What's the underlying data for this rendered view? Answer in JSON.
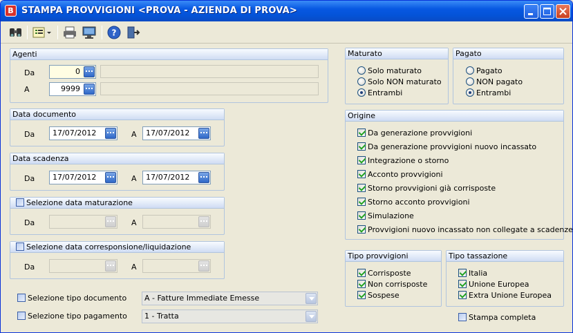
{
  "window": {
    "title": "STAMPA PROVVIGIONI <PROVA - AZIENDA DI PROVA>",
    "app_icon_letter": "B"
  },
  "agenti": {
    "header": "Agenti",
    "da_label": "Da",
    "da_value": "0",
    "a_label": "A",
    "a_value": "9999"
  },
  "data_documento": {
    "header": "Data documento",
    "da_label": "Da",
    "da_value": "17/07/2012",
    "a_label": "A",
    "a_value": "17/07/2012"
  },
  "data_scadenza": {
    "header": "Data scadenza",
    "da_label": "Da",
    "da_value": "17/07/2012",
    "a_label": "A",
    "a_value": "17/07/2012"
  },
  "data_maturazione": {
    "header": "Selezione data maturazione",
    "da_label": "Da",
    "a_label": "A"
  },
  "data_corresponsione": {
    "header": "Selezione data corresponsione/liquidazione",
    "da_label": "Da",
    "a_label": "A"
  },
  "tipo_documento": {
    "label": "Selezione tipo documento",
    "value": "A - Fatture Immediate Emesse"
  },
  "tipo_pagamento": {
    "label": "Selezione tipo pagamento",
    "value": "1 - Tratta"
  },
  "maturato": {
    "header": "Maturato",
    "options": [
      "Solo maturato",
      "Solo NON maturato",
      "Entrambi"
    ],
    "selected": "Entrambi"
  },
  "pagato": {
    "header": "Pagato",
    "options": [
      "Pagato",
      "NON pagato",
      "Entrambi"
    ],
    "selected": "Entrambi"
  },
  "origine": {
    "header": "Origine",
    "items": [
      "Da generazione provvigioni",
      "Da generazione provvigioni nuovo incassato",
      "Integrazione o storno",
      "Acconto provvigioni",
      "Storno provvigioni già corrisposte",
      "Storno acconto provvigioni",
      "Simulazione",
      "Provvigioni nuovo incassato non collegate a scadenze"
    ]
  },
  "tipo_provvigioni": {
    "header": "Tipo provvigioni",
    "items": [
      "Corrisposte",
      "Non corrisposte",
      "Sospese"
    ]
  },
  "tipo_tassazione": {
    "header": "Tipo tassazione",
    "items": [
      "Italia",
      "Unione Europea",
      "Extra Unione Europea"
    ]
  },
  "stampa_completa": {
    "label": "Stampa completa",
    "checked": false
  },
  "toolbar": {
    "icons": [
      "binoculars-icon",
      "list-options-icon",
      "printer-icon",
      "monitor-icon",
      "help-icon",
      "exit-icon"
    ]
  },
  "colors": {
    "title_blue": "#0453d8",
    "group_border": "#b0c4de",
    "input_yellow": "#fffde3",
    "check_green": "#21a121"
  }
}
